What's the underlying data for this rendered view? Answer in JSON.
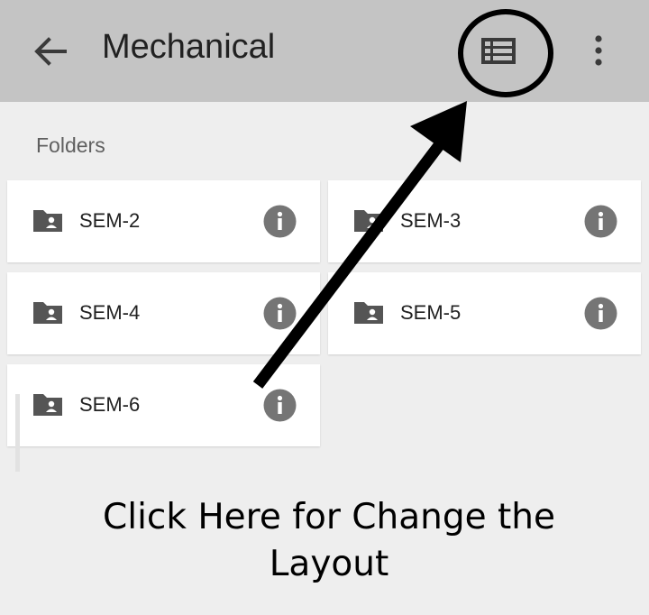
{
  "appbar": {
    "title": "Mechanical",
    "back_icon": "arrow-left-icon",
    "layout_icon": "view-list-icon",
    "more_icon": "more-vert-icon",
    "background": "#c4c4c4"
  },
  "folders_section": {
    "label": "Folders",
    "items": [
      {
        "label": "SEM-2",
        "icon": "shared-folder-icon",
        "info_icon": "info-icon"
      },
      {
        "label": "SEM-3",
        "icon": "shared-folder-icon",
        "info_icon": "info-icon"
      },
      {
        "label": "SEM-4",
        "icon": "shared-folder-icon",
        "info_icon": "info-icon"
      },
      {
        "label": "SEM-5",
        "icon": "shared-folder-icon",
        "info_icon": "info-icon"
      },
      {
        "label": "SEM-6",
        "icon": "shared-folder-icon",
        "info_icon": "info-icon"
      }
    ]
  },
  "annotation": {
    "caption_line1": "Click Here for Change the",
    "caption_line2": "Layout",
    "arrow_color": "#000000"
  }
}
